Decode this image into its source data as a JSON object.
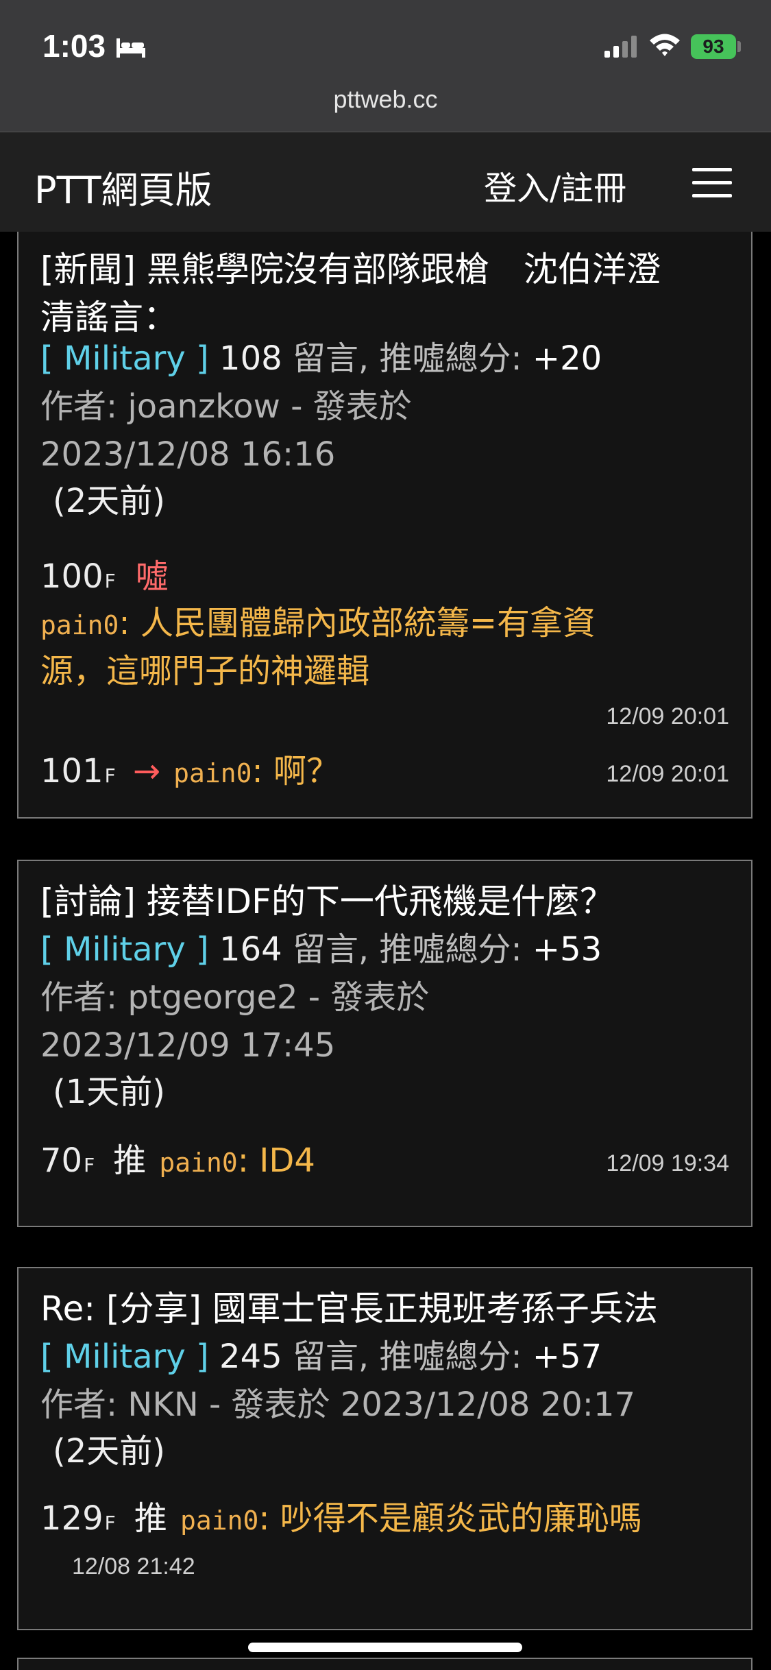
{
  "status": {
    "time": "1:03",
    "battery": "93"
  },
  "browser": {
    "url": "pttweb.cc"
  },
  "header": {
    "title": "PTT網頁版",
    "login": "登入/註冊"
  },
  "posts": [
    {
      "title_line1": "[新聞] 黑熊學院沒有部隊跟槍　沈伯洋澄",
      "title_line2": "清謠言：",
      "board": "[ Military ]",
      "comment_count": "108",
      "meta_label": "留言, 推噓總分:",
      "score": "+20",
      "author_line1": "作者: joanzkow - 發表於",
      "author_line2": "2023/12/08 16:16",
      "ago": "(2天前)",
      "comments": [
        {
          "floor": "100",
          "floor_suffix": "F",
          "tag": "噓",
          "user": "pain0",
          "text_line1": ": 人民團體歸內政部統籌=有拿資",
          "text_line2": "源，這哪門子的神邏輯",
          "time": "12/09 20:01"
        },
        {
          "floor": "101",
          "floor_suffix": "F",
          "tag": "→",
          "user": "pain0",
          "text": ": 啊？",
          "time": "12/09 20:01"
        }
      ]
    },
    {
      "title_line1": "[討論] 接替IDF的下一代飛機是什麼？",
      "board": "[ Military ]",
      "comment_count": "164",
      "meta_label": "留言, 推噓總分:",
      "score": "+53",
      "author_line1": "作者: ptgeorge2 - 發表於",
      "author_line2": "2023/12/09 17:45",
      "ago": "(1天前)",
      "comments": [
        {
          "floor": "70",
          "floor_suffix": "F",
          "tag": "推",
          "user": "pain0",
          "text": ": ID4",
          "time": "12/09 19:34"
        }
      ]
    },
    {
      "title_line1": "Re: [分享] 國軍士官長正規班考孫子兵法",
      "board": "[ Military ]",
      "comment_count": "245",
      "meta_label": "留言, 推噓總分:",
      "score": "+57",
      "author_line1": "作者: NKN - 發表於 2023/12/08 20:17",
      "ago": "(2天前)",
      "comments": [
        {
          "floor": "129",
          "floor_suffix": "F",
          "tag": "推",
          "user": "pain0",
          "text": ": 吵得不是顧炎武的廉恥嗎",
          "time": "12/08 21:42"
        }
      ]
    }
  ]
}
